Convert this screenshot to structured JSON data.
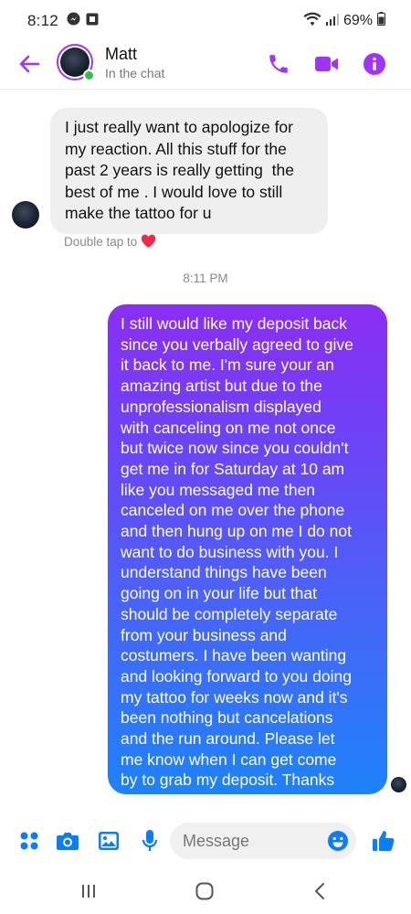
{
  "status_bar": {
    "time": "8:12",
    "battery": "69%",
    "icons": [
      "messenger-notification-icon",
      "gallery-notification-icon",
      "wifi-icon",
      "signal-icon",
      "battery-icon"
    ]
  },
  "header": {
    "contact_name": "Matt",
    "contact_status": "In the chat",
    "online": true,
    "accent_color": "#a133ff",
    "actions": [
      "phone-icon",
      "video-camera-icon",
      "info-icon"
    ]
  },
  "messages": [
    {
      "direction": "incoming",
      "lines": [
        "I just really want to apologize for",
        "my reaction. All this stuff for the",
        "past 2 years is really getting  the",
        "best of me . I would love to still",
        "make the tattoo for u"
      ],
      "hint": "Double tap to",
      "hint_icon": "heart-icon"
    },
    {
      "direction": "timestamp",
      "text": "8:11 PM"
    },
    {
      "direction": "outgoing",
      "lines": [
        "I still would like my deposit back",
        "since you verbally agreed to give",
        "it back to me. I'm sure your an",
        "amazing artist but due to the",
        "unprofessionalism displayed",
        "with canceling on me not once",
        "but twice now since you couldn't",
        "get me in for Saturday at 10 am",
        "like you messaged me then",
        "canceled on me over the phone",
        "and then hung up on me I do not",
        "want to do business with you. I",
        "understand things have been",
        "going on in your life but that",
        "should be completely separate",
        "from your business and",
        "costumers. I have been wanting",
        "and looking forward to you doing",
        "my tattoo for weeks now and it's",
        "been nothing but cancelations",
        "and the run around. Please let",
        "me know when I can get come",
        "by to grab my deposit. Thanks"
      ],
      "gradient_top": "#8a2ef4",
      "gradient_bottom": "#1e82f9"
    }
  ],
  "composer": {
    "placeholder": "Message",
    "icons": [
      "apps-grid-icon",
      "camera-icon",
      "image-icon",
      "microphone-icon",
      "emoji-icon",
      "thumbs-up-icon"
    ],
    "accent_color": "#0a7cff"
  },
  "nav_bar": {
    "buttons": [
      "recent-apps-icon",
      "home-icon",
      "back-nav-icon"
    ]
  }
}
